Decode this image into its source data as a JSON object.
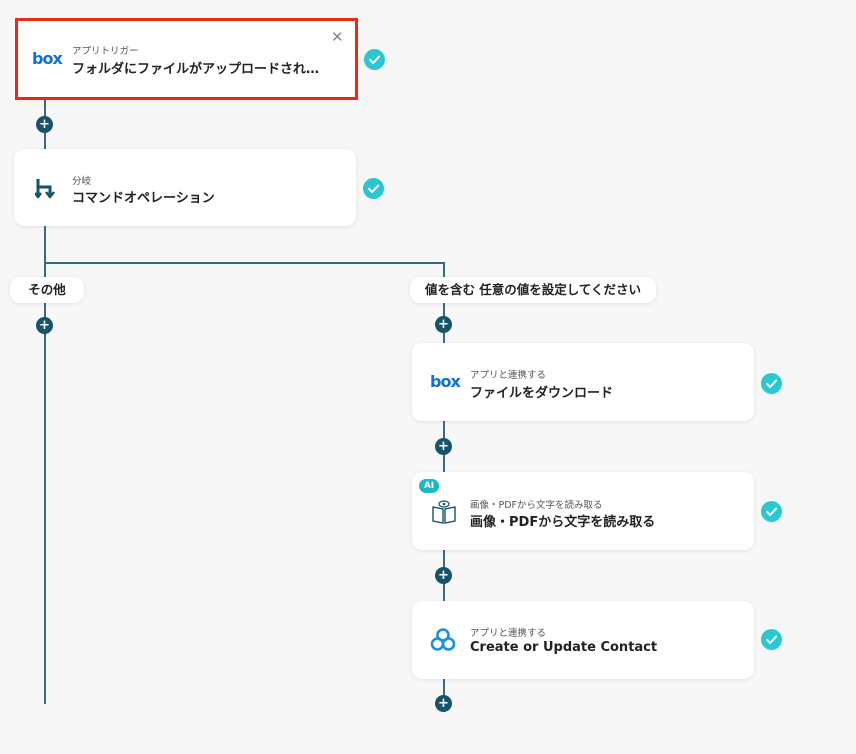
{
  "colors": {
    "line": "#3a6a80",
    "plus_button": "#17536a",
    "check": "#2bc6d2",
    "selected_border": "#ee2b1a",
    "box_brand": "#0d6fd8",
    "ai_badge": "#1bb8c4"
  },
  "steps": {
    "trigger": {
      "sub": "アプリトリガー",
      "title": "フォルダにファイルがアップロードされ…",
      "icon": "box-logo-icon",
      "logo_text": "box"
    },
    "branch": {
      "sub": "分岐",
      "title": "コマンドオペレーション",
      "icon": "branch-icon"
    },
    "download": {
      "sub": "アプリと連携する",
      "title": "ファイルをダウンロード",
      "icon": "box-logo-icon",
      "logo_text": "box"
    },
    "ocr": {
      "sub": "画像・PDFから文字を読み取る",
      "title": "画像・PDFから文字を読み取る",
      "icon": "book-eye-icon",
      "badge": "AI"
    },
    "contact": {
      "sub": "アプリと連携する",
      "title": "Create or Update Contact",
      "icon": "triangle-rings-icon"
    }
  },
  "branches": {
    "other": "その他",
    "condition": "値を含む 任意の値を設定してください"
  },
  "controls": {
    "plus": "+"
  },
  "footer": ""
}
